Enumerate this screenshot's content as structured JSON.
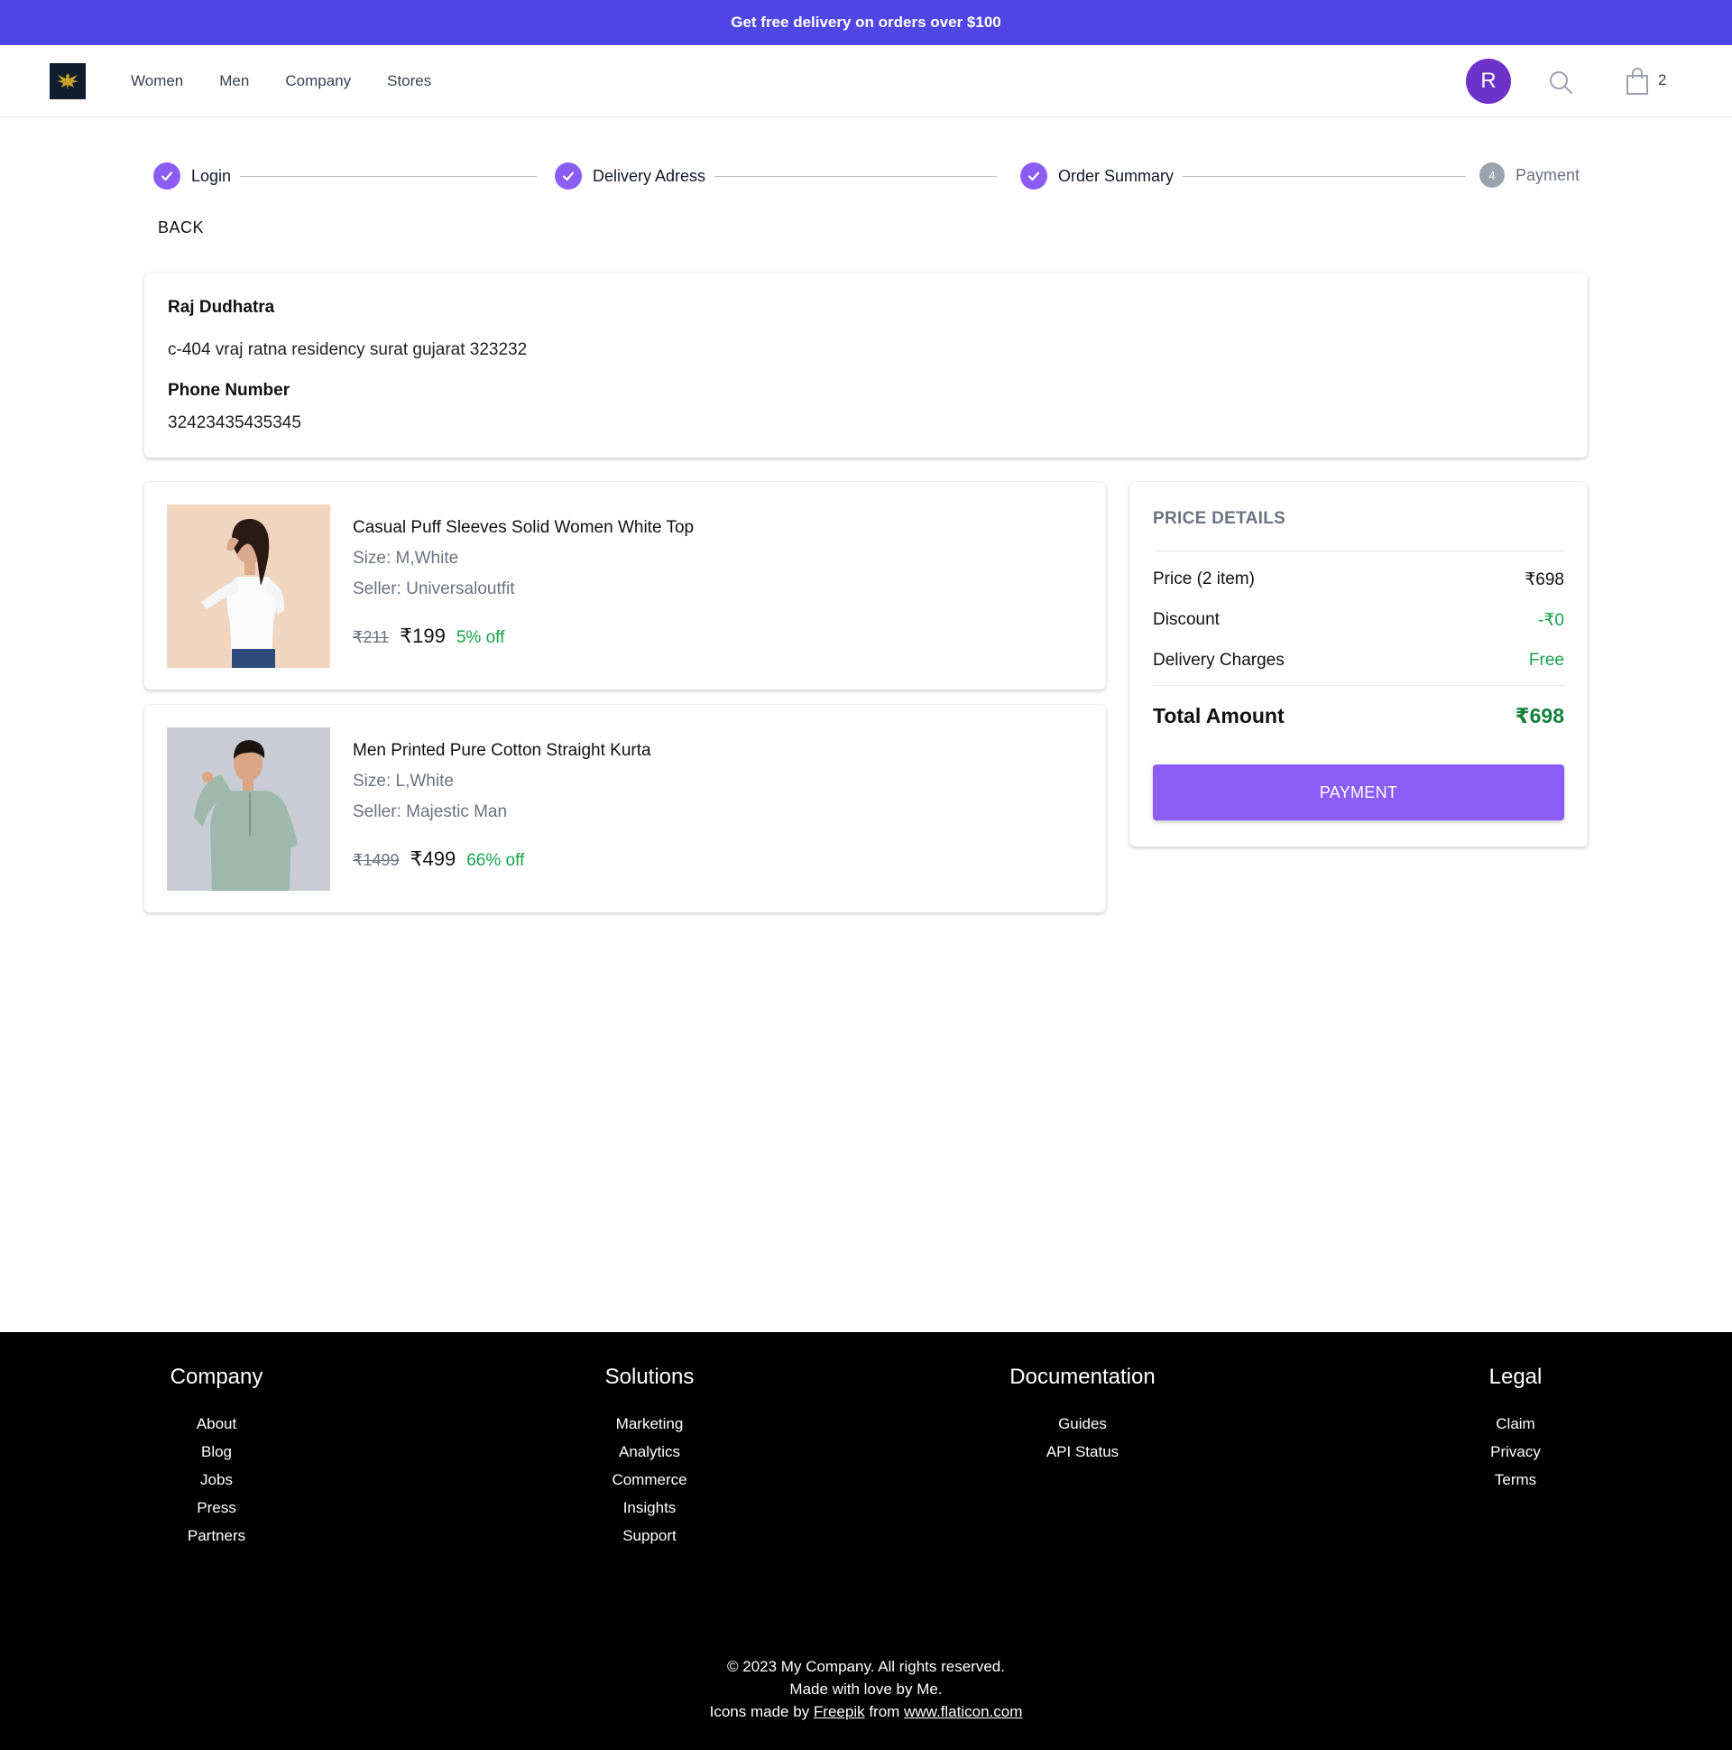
{
  "promo": {
    "text": "Get free delivery on orders over $100"
  },
  "nav": {
    "items": [
      "Women",
      "Men",
      "Company",
      "Stores"
    ]
  },
  "header": {
    "avatar_initial": "R",
    "cart_count": "2"
  },
  "stepper": {
    "steps": [
      {
        "label": "Login",
        "done": true
      },
      {
        "label": "Delivery Adress",
        "done": true
      },
      {
        "label": "Order Summary",
        "done": true
      },
      {
        "label": "Payment",
        "done": false,
        "number": "4"
      }
    ]
  },
  "back_label": "BACK",
  "address": {
    "name": "Raj Dudhatra",
    "line": "c-404 vraj ratna residency surat gujarat 323232",
    "phone_label": "Phone Number",
    "phone": "32423435435345"
  },
  "items": [
    {
      "title": "Casual Puff Sleeves Solid Women White Top",
      "size": "Size: M,White",
      "seller": "Seller: Universaloutfit",
      "orig_price": "₹211",
      "price": "₹199",
      "off": "5% off"
    },
    {
      "title": "Men Printed Pure Cotton Straight Kurta",
      "size": "Size: L,White",
      "seller": "Seller: Majestic Man",
      "orig_price": "₹1499",
      "price": "₹499",
      "off": "66% off"
    }
  ],
  "price_details": {
    "heading": "PRICE DETAILS",
    "price_label": "Price (2 item)",
    "price_value": "₹698",
    "discount_label": "Discount",
    "discount_value": "-₹0",
    "delivery_label": "Delivery Charges",
    "delivery_value": "Free",
    "total_label": "Total Amount",
    "total_value": "₹698",
    "button": "PAYMENT"
  },
  "footer": {
    "columns": [
      {
        "title": "Company",
        "links": [
          "About",
          "Blog",
          "Jobs",
          "Press",
          "Partners"
        ]
      },
      {
        "title": "Solutions",
        "links": [
          "Marketing",
          "Analytics",
          "Commerce",
          "Insights",
          "Support"
        ]
      },
      {
        "title": "Documentation",
        "links": [
          "Guides",
          "API Status"
        ]
      },
      {
        "title": "Legal",
        "links": [
          "Claim",
          "Privacy",
          "Terms"
        ]
      }
    ],
    "copyright": "© 2023 My Company. All rights reserved.",
    "made_with": "Made with love by Me.",
    "icons_prefix": "Icons made by",
    "icons_author": "Freepik",
    "icons_from": "from",
    "icons_site": "www.flaticon.com"
  },
  "colors": {
    "brand": "#4f46e5",
    "accent": "#8b5cf6",
    "success": "#16a34a",
    "avatar": "#6d32c9"
  }
}
